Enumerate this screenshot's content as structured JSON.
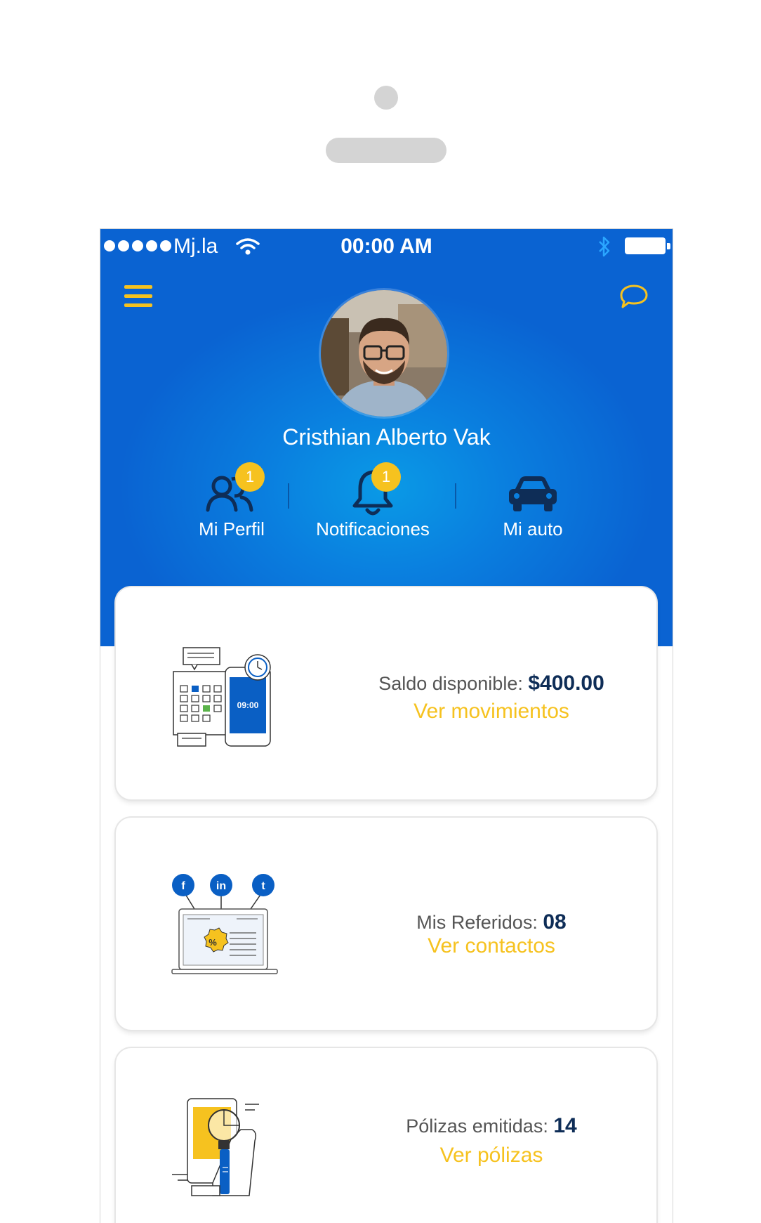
{
  "status_bar": {
    "carrier": "Mj.la",
    "time": "00:00 AM"
  },
  "header": {
    "menu_icon": "hamburger-menu-icon",
    "chat_icon": "chat-bubble-icon",
    "user_name": "Cristhian Alberto Vak"
  },
  "quick_actions": [
    {
      "label": "Mi Perfil",
      "icon": "users-icon",
      "badge": "1"
    },
    {
      "label": "Notificaciones",
      "icon": "bell-icon",
      "badge": "1"
    },
    {
      "label": "Mi auto",
      "icon": "car-icon"
    }
  ],
  "cards": {
    "saldo": {
      "label": "Saldo disponible:",
      "value": "$400.00",
      "link": "Ver movimientos",
      "phone_time": "09:00"
    },
    "referidos": {
      "label": "Mis Referidos:",
      "value": "08",
      "link": "Ver contactos",
      "social": [
        "f",
        "in",
        "t"
      ],
      "promo": "%"
    },
    "polizas": {
      "label": "Pólizas emitidas:",
      "value": "14",
      "link": "Ver pólizas"
    }
  },
  "colors": {
    "primary_blue": "#0a6fd8",
    "accent_yellow": "#f6c21f",
    "navy": "#0e2d57"
  }
}
